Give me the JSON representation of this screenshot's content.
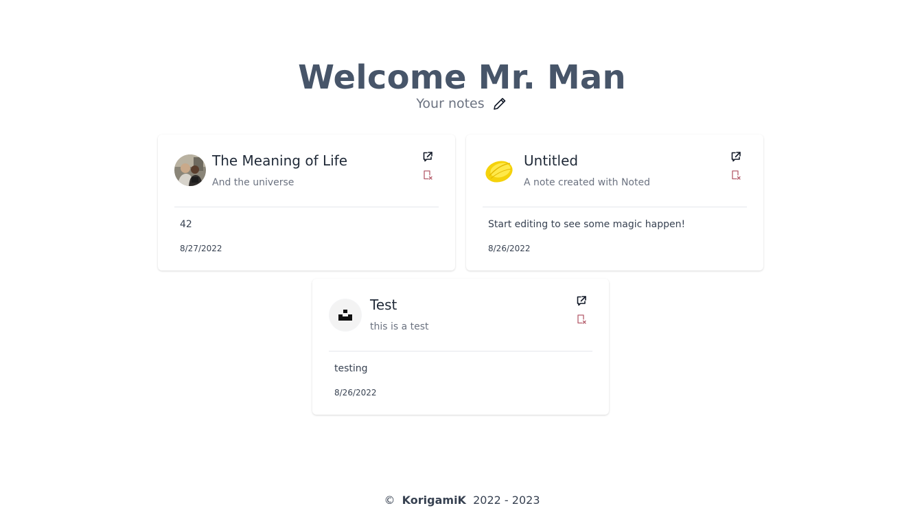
{
  "header": {
    "title": "Welcome Mr. Man",
    "subtitle": "Your notes",
    "edit_icon": "pencil-icon"
  },
  "notes": [
    {
      "title": "The Meaning of Life",
      "description": "And the universe",
      "content": "42",
      "date": "8/27/2022",
      "avatar": "photo-avatar",
      "open_icon": "external-link-icon",
      "delete_icon": "delete-note-icon"
    },
    {
      "title": "Untitled",
      "description": "A note created with Noted",
      "content": "Start editing to see some magic happen!",
      "date": "8/26/2022",
      "avatar": "lemon-avatar",
      "open_icon": "external-link-icon",
      "delete_icon": "delete-note-icon"
    },
    {
      "title": "Test",
      "description": "this is a test",
      "content": "testing",
      "date": "8/26/2022",
      "avatar": "unsplash-logo-avatar",
      "open_icon": "external-link-icon",
      "delete_icon": "delete-note-icon"
    }
  ],
  "footer": {
    "copyright": "©",
    "brand": "KorigamiK",
    "years": "2022 - 2023"
  },
  "colors": {
    "heading": "#475569",
    "delete_icon": "#b45b6a",
    "divider": "#e5e7eb"
  }
}
